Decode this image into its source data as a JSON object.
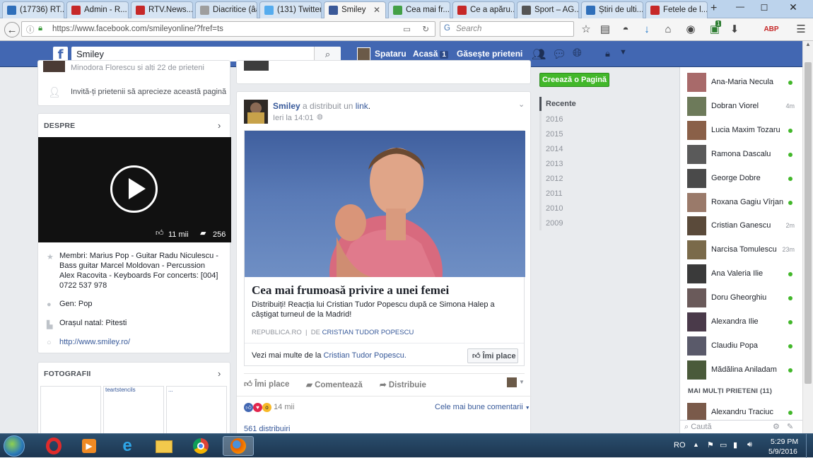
{
  "browser": {
    "tabs": [
      {
        "label": "(17736) RT...",
        "color": "#2f6fba"
      },
      {
        "label": "Admin - R...",
        "color": "#c62828"
      },
      {
        "label": "RTV.News...",
        "color": "#c62828"
      },
      {
        "label": "Diacritice (âăîș...",
        "color": "#9e9e9e"
      },
      {
        "label": "(131) Twitter",
        "color": "#55acee"
      },
      {
        "label": "Smiley",
        "color": "#3b5998"
      },
      {
        "label": "Cea mai fr...",
        "color": "#43a047"
      },
      {
        "label": "Ce a apăru...",
        "color": "#c62828"
      },
      {
        "label": "Sport – AG...",
        "color": "#555555"
      },
      {
        "label": "Știri de ulti...",
        "color": "#2f6fba"
      },
      {
        "label": "Fetele de l...",
        "color": "#c62828"
      }
    ],
    "active_tab": "Smiley",
    "url": "https://www.facebook.com/smileyonline/?fref=ts",
    "search_placeholder": "Search",
    "new_tab": "+",
    "notif_badge": "1"
  },
  "fb_header": {
    "logo": "f",
    "search_value": "Smiley",
    "user": "Spataru",
    "home": "Acasă",
    "home_badge": "1",
    "find_friends": "Găsește prieteni"
  },
  "left": {
    "top_snippet": "Minodora Florescu și alți 22 de prieteni",
    "invite": "Invită-ți prietenii să aprecieze această pagină",
    "about_header": "DESPRE",
    "video_likes": "11 mii",
    "video_comments": "256",
    "members": "Membri: Marius Pop - Guitar Radu Niculescu - Bass guitar Marcel Moldovan - Percussion Alex Racovita - Keyboards For concerts: [004] 0722 537 978",
    "genre": "Gen: Pop",
    "hometown": "Orașul natal: Pitesti",
    "website": "http://www.smiley.ro/",
    "photos_header": "FOTOGRAFII",
    "photo_captions": [
      "teartstencils",
      "..."
    ]
  },
  "post": {
    "author": "Smiley",
    "action": "a distribuit un",
    "link_word": "link",
    "time": "Ieri la 14:01",
    "headline": "Cea mai frumoasă privire a unei femei",
    "description": "Distribuiți! Reacția lui Cristian Tudor Popescu după ce Simona Halep a câștigat turneul de la Madrid!",
    "source": "REPUBLICA.RO",
    "by": "DE",
    "source_author": "CRISTIAN TUDOR POPESCU",
    "see_more": "Vezi mai multe de la",
    "see_more_author": "Cristian Tudor Popescu.",
    "like_page": "Îmi place",
    "like": "Îmi place",
    "comment": "Comentează",
    "share": "Distribuie",
    "reactions": "14 mii",
    "best_comments": "Cele mai bune comentarii",
    "shares": "561 distribuiri"
  },
  "timeline": {
    "create_page": "Creează o Pagină",
    "recent": "Recente",
    "years": [
      "2016",
      "2015",
      "2014",
      "2013",
      "2012",
      "2011",
      "2010",
      "2009"
    ]
  },
  "chat": {
    "friends": [
      {
        "name": "Ana-Maria Necula",
        "status": "online"
      },
      {
        "name": "Dobran Viorel",
        "status": "4m"
      },
      {
        "name": "Lucia Maxim Tozaru",
        "status": "online"
      },
      {
        "name": "Ramona Dascalu",
        "status": "online"
      },
      {
        "name": "George Dobre",
        "status": "online"
      },
      {
        "name": "Roxana Gagiu Vîrjan",
        "status": "online"
      },
      {
        "name": "Cristian Ganescu",
        "status": "2m"
      },
      {
        "name": "Narcisa Tomulescu",
        "status": "23m"
      },
      {
        "name": "Ana Valeria Ilie",
        "status": "online"
      },
      {
        "name": "Doru Gheorghiu",
        "status": "online"
      },
      {
        "name": "Alexandra Ilie",
        "status": "online"
      },
      {
        "name": "Claudiu Popa",
        "status": "online"
      },
      {
        "name": "Mădălina Aniladam",
        "status": "online"
      }
    ],
    "more_header": "MAI MULȚI PRIETENI (11)",
    "more_friend": "Alexandru Traciuc",
    "search_placeholder": "Caută"
  },
  "taskbar": {
    "language": "RO",
    "time": "5:29 PM",
    "date": "5/9/2016"
  }
}
